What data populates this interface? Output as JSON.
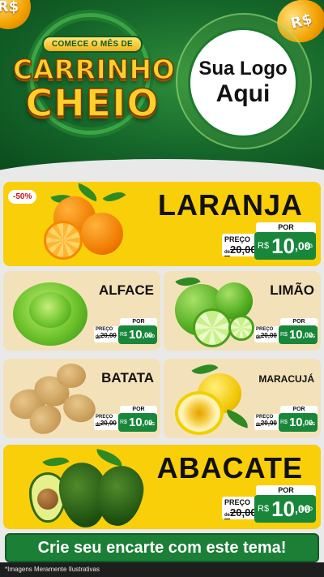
{
  "header": {
    "coin_symbol": "R$",
    "promo_tag": "COMECE O MÊS DE",
    "promo_line1": "CARRINHO",
    "promo_line2": "CHEIO",
    "logo_line1": "Sua Logo",
    "logo_line2": "Aqui"
  },
  "products": {
    "laranja": {
      "name": "LARANJA",
      "badge": "-50%",
      "por": "POR",
      "preco_label": "PREÇO",
      "de": "de",
      "old": "20,00",
      "currency": "R$",
      "int": "10",
      "dec": ",00",
      "unit": "KG"
    },
    "alface": {
      "name": "ALFACE",
      "por": "POR",
      "preco_label": "PREÇO",
      "de": "de",
      "old": "20,00",
      "currency": "R$",
      "int": "10",
      "dec": ",00",
      "unit": "UNID"
    },
    "limao": {
      "name": "LIMÃO",
      "por": "POR",
      "preco_label": "PREÇO",
      "de": "de",
      "old": "20,00",
      "currency": "R$",
      "int": "10",
      "dec": ",00",
      "unit": "KG"
    },
    "batata": {
      "name": "BATATA",
      "por": "POR",
      "preco_label": "PREÇO",
      "de": "de",
      "old": "20,00",
      "currency": "R$",
      "int": "10",
      "dec": ",00",
      "unit": "KG"
    },
    "maracuja": {
      "name": "MARACUJÁ",
      "por": "POR",
      "preco_label": "PREÇO",
      "de": "de",
      "old": "20,00",
      "currency": "R$",
      "int": "10",
      "dec": ",00",
      "unit": "KG"
    },
    "abacate": {
      "name": "ABACATE",
      "por": "POR",
      "preco_label": "PREÇO",
      "de": "de",
      "old": "20,00",
      "currency": "R$",
      "int": "10",
      "dec": ",00",
      "unit": "UNID"
    }
  },
  "footer": {
    "cta": "Crie seu encarte com este tema!",
    "disclaimer": "*Imagens Meramente Ilustrativas"
  },
  "colors": {
    "header_green": "#15662a",
    "price_green": "#18873a",
    "yellow_card": "#f9cf0a",
    "beige_card": "#f3e2b9"
  }
}
